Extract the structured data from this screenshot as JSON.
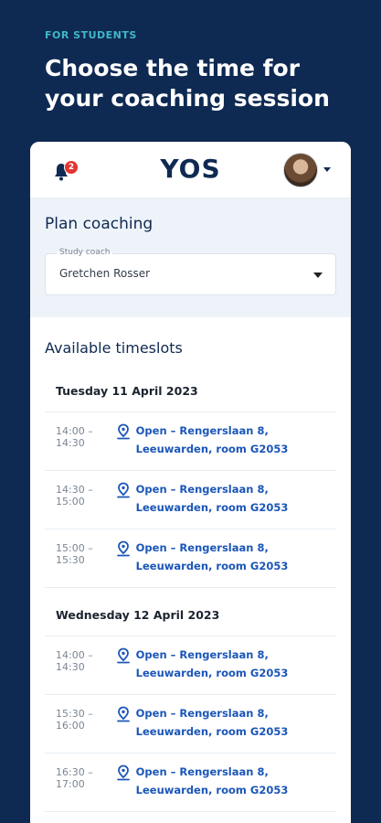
{
  "promo": {
    "kicker": "FOR STUDENTS",
    "headline": "Choose the time for your coaching session"
  },
  "app": {
    "logo": "YOS",
    "notifications_count": "2",
    "icons": {
      "notifications": "bell-icon",
      "avatar_menu": "chevron-down-icon",
      "location": "location-pin-icon"
    },
    "colors": {
      "brand_navy": "#0f2a52",
      "accent_teal": "#3fb8c9",
      "link_blue": "#1b56b8",
      "badge_red": "#e3342f"
    }
  },
  "plan": {
    "title": "Plan coaching",
    "study_coach_label": "Study coach",
    "study_coach_value": "Gretchen Rosser"
  },
  "timeslots": {
    "title": "Available timeslots",
    "days": [
      {
        "date": "Tuesday 11 April 2023",
        "slots": [
          {
            "time": "14:00 – 14:30",
            "location": "Open – Rengerslaan 8, Leeuwarden, room G2053"
          },
          {
            "time": "14:30 – 15:00",
            "location": "Open – Rengerslaan 8, Leeuwarden, room G2053"
          },
          {
            "time": "15:00 – 15:30",
            "location": "Open – Rengerslaan 8, Leeuwarden, room G2053"
          }
        ]
      },
      {
        "date": "Wednesday 12 April 2023",
        "slots": [
          {
            "time": "14:00 – 14:30",
            "location": "Open – Rengerslaan 8, Leeuwarden, room G2053"
          },
          {
            "time": "15:30 – 16:00",
            "location": "Open – Rengerslaan 8, Leeuwarden, room G2053"
          },
          {
            "time": "16:30 – 17:00",
            "location": "Open – Rengerslaan 8, Leeuwarden, room G2053"
          }
        ]
      }
    ]
  }
}
